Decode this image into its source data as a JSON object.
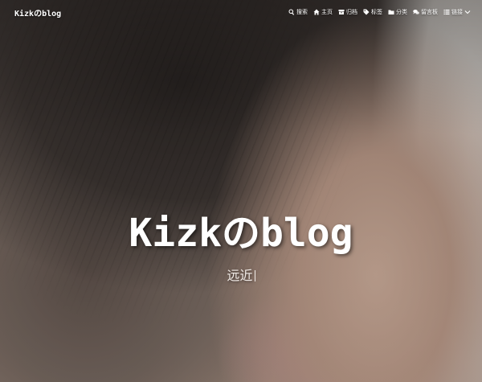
{
  "nav": {
    "brand": "Kizkのblog",
    "items": [
      {
        "label": "搜索",
        "icon": "search-icon"
      },
      {
        "label": "主页",
        "icon": "home-icon"
      },
      {
        "label": "归档",
        "icon": "archive-icon"
      },
      {
        "label": "标签",
        "icon": "tag-icon"
      },
      {
        "label": "分类",
        "icon": "folder-icon"
      },
      {
        "label": "留言板",
        "icon": "comments-icon"
      },
      {
        "label": "链接",
        "icon": "list-icon"
      }
    ]
  },
  "hero": {
    "title": "Kizkのblog",
    "subtitle": "远近"
  }
}
